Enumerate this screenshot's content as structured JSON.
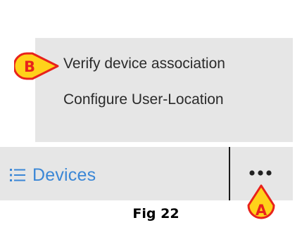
{
  "popup_menu": {
    "items": [
      {
        "label": "Verify device association"
      },
      {
        "label": "Configure User-Location"
      }
    ]
  },
  "toolbar": {
    "devices_label": "Devices",
    "devices_icon": "list-icon",
    "more_icon": "more-dots-icon"
  },
  "callouts": {
    "a": "A",
    "b": "B"
  },
  "caption": "Fig 22",
  "colors": {
    "panel_bg": "#e6e6e6",
    "accent_blue": "#3b87d6",
    "callout_fill": "#ffd21a",
    "callout_stroke": "#e8221c"
  }
}
